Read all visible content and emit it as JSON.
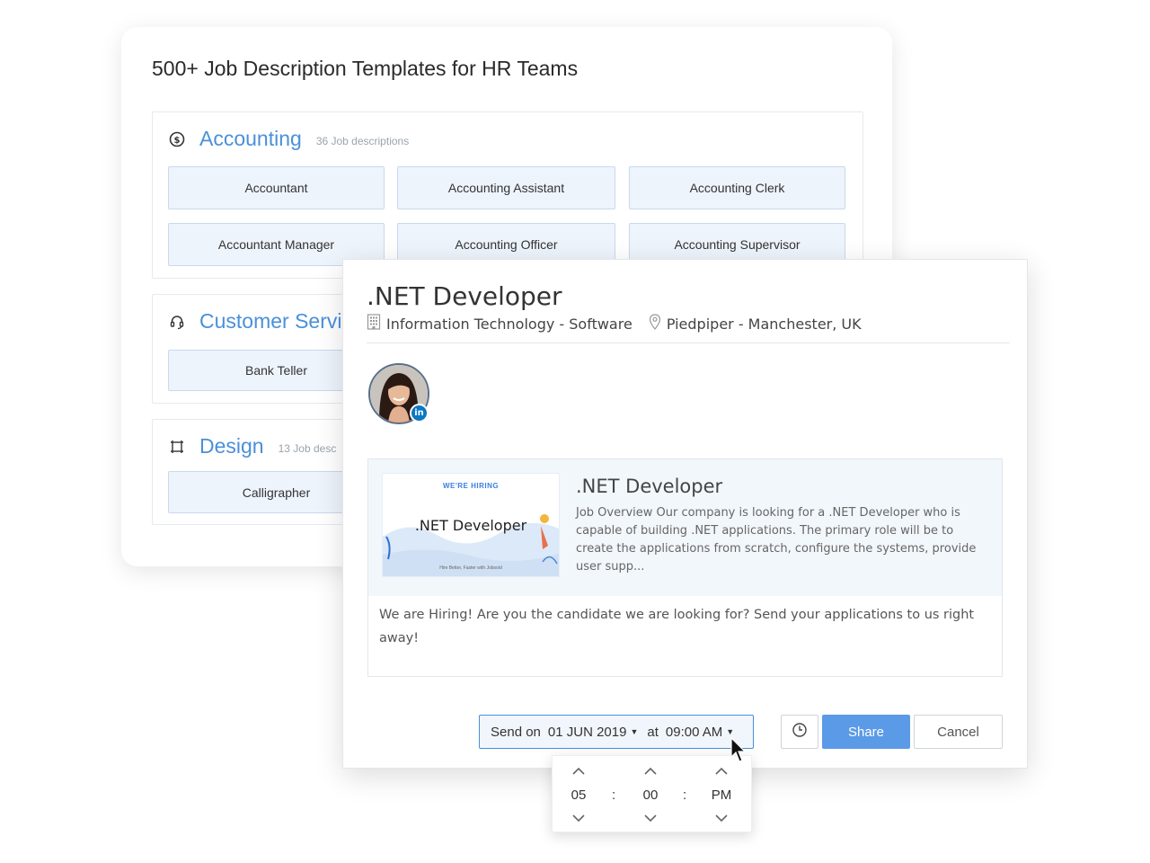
{
  "background": {
    "title": "500+ Job Description Templates for HR Teams",
    "sections": [
      {
        "name": "Accounting",
        "icon": "dollar-circle-icon",
        "count": "36 Job descriptions",
        "jobs": [
          "Accountant",
          "Accounting Assistant",
          "Accounting Clerk",
          "Accountant Manager",
          "Accounting Officer",
          "Accounting Supervisor"
        ]
      },
      {
        "name": "Customer Servi",
        "icon": "headset-icon",
        "count": "",
        "jobs": [
          "Bank Teller"
        ]
      },
      {
        "name": "Design",
        "icon": "crop-frame-icon",
        "count": "13 Job desc",
        "jobs": [
          "Calligrapher"
        ]
      }
    ]
  },
  "modal": {
    "title": ".NET Developer",
    "department": "Information Technology - Software",
    "location": "Piedpiper - Manchester, UK",
    "avatar_badge": "in",
    "preview": {
      "image_hiring": "WE'RE HIRING",
      "image_title": ".NET Developer",
      "image_footer": "Hire Better, Faster with Jobsoid",
      "title": ".NET Developer",
      "description": "Job Overview Our company is looking for a .NET Developer who is capable of building .NET applications. The primary role will be to create the applications from scratch, configure the systems, provide user supp..."
    },
    "message": "We are Hiring! Are you the candidate we are looking for? Send your applications to us right away!",
    "schedule": {
      "send_label": "Send on",
      "date": "01 JUN 2019",
      "at_label": "at",
      "time": "09:00 AM"
    },
    "share_label": "Share",
    "cancel_label": "Cancel",
    "picker": {
      "hour": "05",
      "minute": "00",
      "period": "PM",
      "separator": ":"
    }
  },
  "colors": {
    "accent": "#4a90d9",
    "share_button": "#5b9ae6",
    "job_button_bg": "#eef4fc",
    "linkedin": "#0a78c2"
  }
}
